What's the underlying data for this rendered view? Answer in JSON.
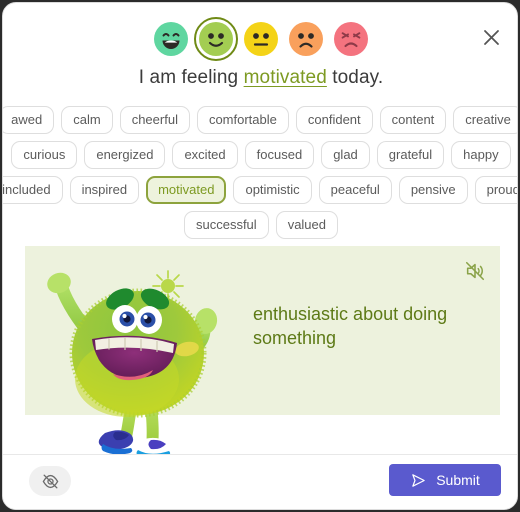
{
  "window": {
    "close_label": "×",
    "close_icon": "close-icon"
  },
  "mood_scale": {
    "options": [
      {
        "id": "very-happy",
        "icon": "grinning-face-icon",
        "label": "very happy",
        "color": "#5fd6a0",
        "selected": false
      },
      {
        "id": "happy",
        "icon": "smiling-face-icon",
        "label": "happy",
        "color": "#a3cd52",
        "selected": true
      },
      {
        "id": "neutral",
        "icon": "neutral-face-icon",
        "label": "neutral",
        "color": "#f4d317",
        "selected": false
      },
      {
        "id": "sad",
        "icon": "frowning-face-icon",
        "label": "sad",
        "color": "#f9a05c",
        "selected": false
      },
      {
        "id": "very-sad",
        "icon": "distressed-face-icon",
        "label": "very sad",
        "color": "#f4737f",
        "selected": false
      }
    ]
  },
  "prompt": {
    "before": "I am feeling ",
    "highlight": "motivated",
    "after": " today."
  },
  "feeling_chips": {
    "selected": "motivated",
    "rows": [
      [
        "awed",
        "calm",
        "cheerful",
        "comfortable",
        "confident",
        "content",
        "creative"
      ],
      [
        "curious",
        "energized",
        "excited",
        "focused",
        "glad",
        "grateful",
        "happy"
      ],
      [
        "included",
        "inspired",
        "motivated",
        "optimistic",
        "peaceful",
        "pensive",
        "proud"
      ],
      [
        "successful",
        "valued"
      ]
    ]
  },
  "definition_panel": {
    "text": "enthusiastic about doing something",
    "audio_icon": "speaker-mute-icon",
    "audio_state": "muted",
    "illustration": "green-monster-character-icon",
    "background_color": "#edf2dd",
    "text_color": "#5d7a16"
  },
  "footer": {
    "hide_icon": "eye-off-icon",
    "submit_label": "Submit",
    "submit_icon": "send-plane-icon",
    "submit_color": "#5a5ace"
  }
}
